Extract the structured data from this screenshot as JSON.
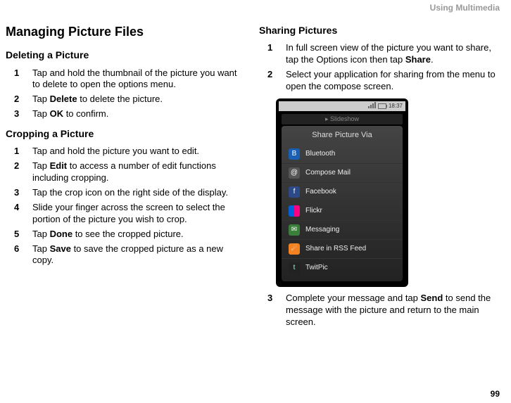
{
  "header": {
    "chapter": "Using Multimedia"
  },
  "pagenum": "99",
  "left": {
    "title": "Managing Picture Files",
    "deleting": {
      "heading": "Deleting a Picture",
      "steps": [
        {
          "num": "1",
          "pre": "Tap and hold the thumbnail of the picture you want to delete to open the options menu."
        },
        {
          "num": "2",
          "pre": "Tap ",
          "bold": "Delete",
          "post": " to delete the picture."
        },
        {
          "num": "3",
          "pre": "Tap ",
          "bold": "OK",
          "post": " to confirm."
        }
      ]
    },
    "cropping": {
      "heading": "Cropping a Picture",
      "steps": [
        {
          "num": "1",
          "pre": "Tap and hold the picture you want to edit."
        },
        {
          "num": "2",
          "pre": "Tap ",
          "bold": "Edit",
          "post": " to access a number of edit functions including cropping."
        },
        {
          "num": "3",
          "pre": "Tap the crop icon on the right side of the display."
        },
        {
          "num": "4",
          "pre": "Slide your finger across the screen to select the portion of the picture you wish to crop."
        },
        {
          "num": "5",
          "pre": "Tap ",
          "bold": "Done",
          "post": " to see the cropped picture."
        },
        {
          "num": "6",
          "pre": "Tap ",
          "bold": "Save",
          "post": " to save the cropped picture as a new copy."
        }
      ]
    }
  },
  "right": {
    "sharing": {
      "heading": "Sharing Pictures",
      "steps_a": [
        {
          "num": "1",
          "pre": "In full screen view of the picture you want to share, tap the Options icon then tap ",
          "bold": "Share",
          "post": "."
        },
        {
          "num": "2",
          "pre": "Select your application for sharing from the menu to open the compose screen."
        }
      ],
      "steps_b": [
        {
          "num": "3",
          "pre": "Complete your message and tap ",
          "bold": "Send",
          "post": " to send the message with the picture and return to the main screen."
        }
      ]
    }
  },
  "phone": {
    "time": "18:37",
    "slideshow": "Slideshow",
    "title": "Share Picture Via",
    "rows": [
      {
        "label": "Bluetooth",
        "cls": "bt-icon",
        "glyph": "B"
      },
      {
        "label": "Compose Mail",
        "cls": "mail-icon",
        "glyph": "@"
      },
      {
        "label": "Facebook",
        "cls": "fb-icon",
        "glyph": "f"
      },
      {
        "label": "Flickr",
        "cls": "flickr-icon",
        "glyph": ""
      },
      {
        "label": "Messaging",
        "cls": "msg-icon",
        "glyph": "✉"
      },
      {
        "label": "Share in RSS Feed",
        "cls": "rss-icon",
        "glyph": "☄"
      },
      {
        "label": "TwitPic",
        "cls": "twit-icon",
        "glyph": "t"
      }
    ]
  }
}
